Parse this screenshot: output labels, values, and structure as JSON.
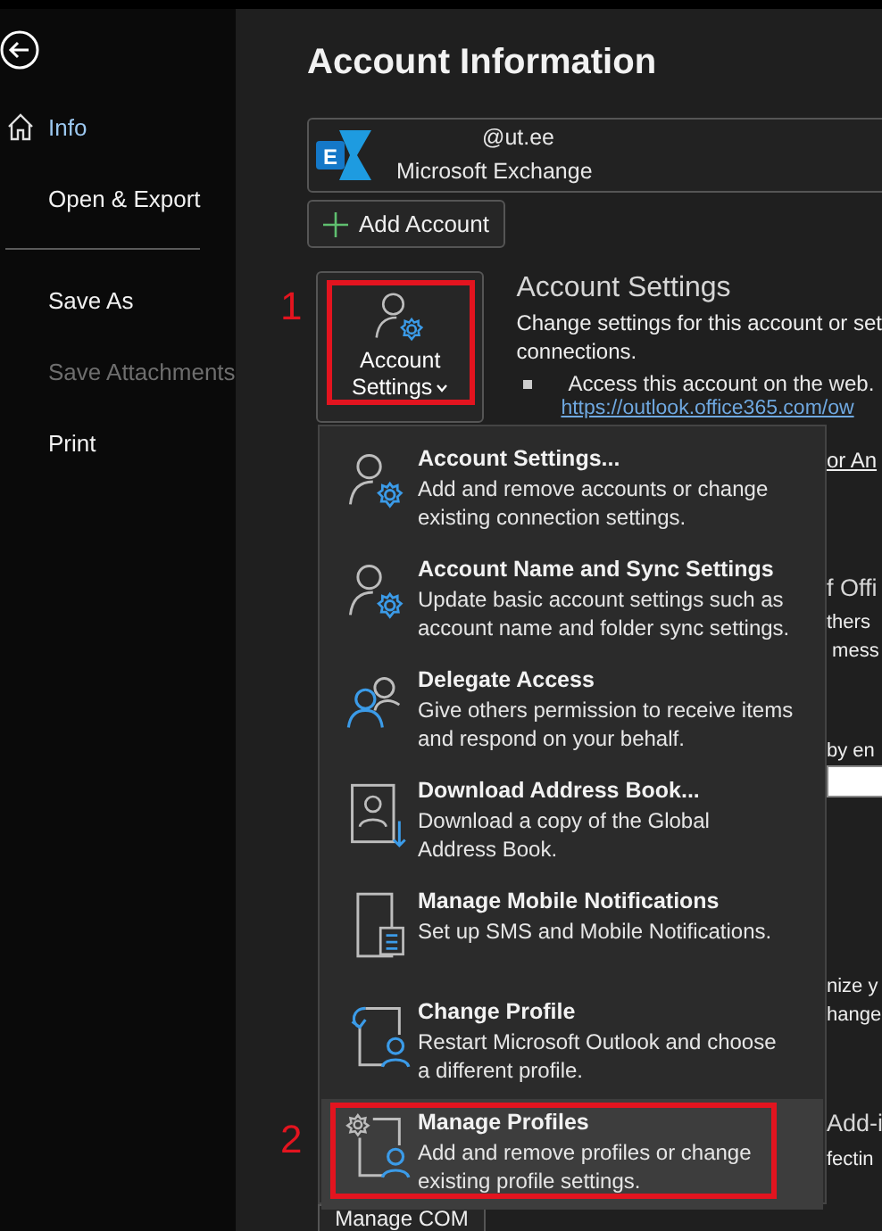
{
  "sidebar": {
    "items": [
      {
        "label": "Info",
        "kind": "home",
        "selected": true,
        "disabled": false,
        "divider_after": false
      },
      {
        "label": "Open & Export",
        "kind": "text",
        "selected": false,
        "disabled": false,
        "divider_after": true
      },
      {
        "label": "Save As",
        "kind": "text",
        "selected": false,
        "disabled": false,
        "divider_after": false
      },
      {
        "label": "Save Attachments",
        "kind": "text",
        "selected": false,
        "disabled": true,
        "divider_after": false
      },
      {
        "label": "Print",
        "kind": "text",
        "selected": false,
        "disabled": false,
        "divider_after": false
      }
    ]
  },
  "main": {
    "title": "Account Information",
    "account": {
      "logo_letter": "E",
      "email": "@ut.ee",
      "type": "Microsoft Exchange"
    },
    "add_account": "Add Account",
    "account_settings_button": {
      "label": "Account Settings",
      "highlighted": true,
      "annotation": "1"
    },
    "account_settings": {
      "heading": "Account Settings",
      "description": "Change settings for this account or set\nconnections.",
      "bullet": "Access this account on the web.",
      "link": "https://outlook.office365.com/ow"
    },
    "partial_texts": [
      {
        "kind": "link",
        "text": "or An"
      },
      {
        "kind": "heading",
        "text": "f Offi"
      },
      {
        "kind": "text",
        "text": "thers"
      },
      {
        "kind": "text",
        "text": " mess"
      },
      {
        "kind": "text",
        "text": "by en"
      },
      {
        "kind": "field"
      },
      {
        "kind": "text",
        "text": "nize y"
      },
      {
        "kind": "text",
        "text": "hange"
      },
      {
        "kind": "heading",
        "text": "Add-i"
      },
      {
        "kind": "text",
        "text": "fectin"
      }
    ],
    "manage_com": "Manage COM"
  },
  "menu": {
    "items": [
      {
        "kind": "settings",
        "title": "Account Settings...",
        "description": "Add and remove accounts or change\nexisting connection settings.",
        "hovered": false,
        "highlighted": false
      },
      {
        "kind": "settings",
        "title": "Account Name and Sync Settings",
        "description": "Update basic account settings such as\naccount name and folder sync settings.",
        "hovered": false,
        "highlighted": false
      },
      {
        "kind": "delegate",
        "title": "Delegate Access",
        "description": "Give others permission to receive items\nand respond on your behalf.",
        "hovered": false,
        "highlighted": false
      },
      {
        "kind": "download",
        "title": "Download Address Book...",
        "description": "Download a copy of the Global\nAddress Book.",
        "hovered": false,
        "highlighted": false
      },
      {
        "kind": "mobile",
        "title": "Manage Mobile Notifications",
        "description": "Set up SMS and Mobile Notifications.",
        "hovered": false,
        "highlighted": false
      },
      {
        "kind": "change",
        "title": "Change Profile",
        "description": "Restart Microsoft Outlook and choose\na different profile.",
        "hovered": false,
        "highlighted": false
      },
      {
        "kind": "manage",
        "title": "Manage Profiles",
        "description": "Add and remove profiles or change\nexisting profile settings.",
        "hovered": true,
        "highlighted": true,
        "annotation": "2"
      }
    ]
  }
}
